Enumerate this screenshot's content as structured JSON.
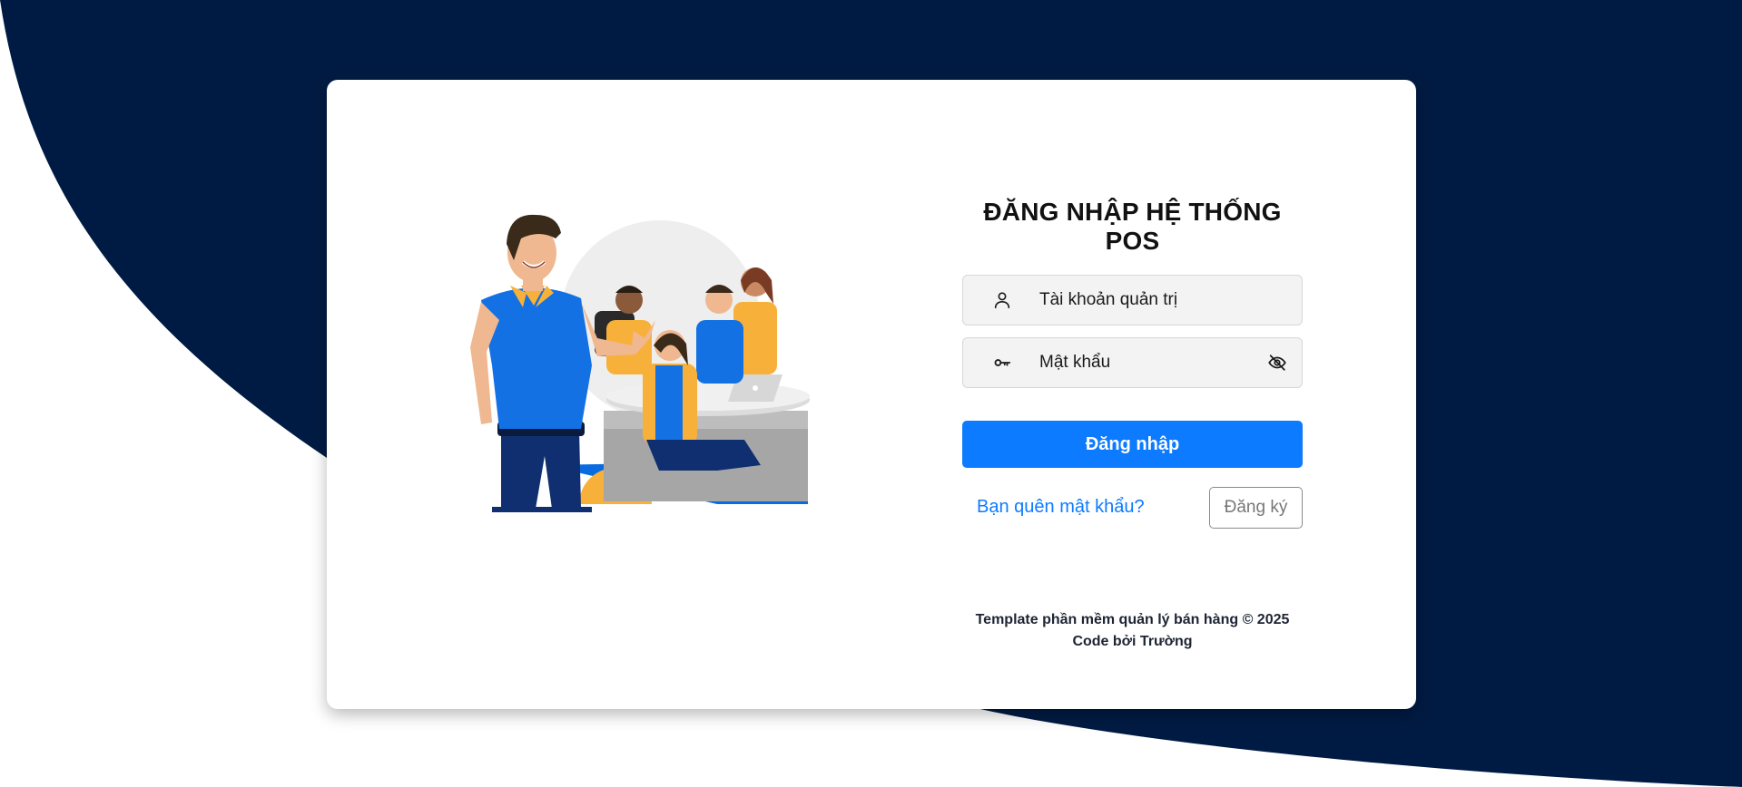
{
  "colors": {
    "navy_background": "#001b43",
    "primary": "#0d7bff",
    "card": "#ffffff"
  },
  "illustration": {
    "name": "team-illustration"
  },
  "login": {
    "title": "ĐĂNG NHẬP HỆ THỐNG POS",
    "username": {
      "placeholder": "Tài khoản quản trị",
      "value": "",
      "icon": "user-icon"
    },
    "password": {
      "placeholder": "Mật khẩu",
      "value": "",
      "icon": "key-icon",
      "toggle_icon": "eye-off-icon"
    },
    "submit_label": "Đăng nhập",
    "forgot_label": "Bạn quên mật khẩu?",
    "register_label": "Đăng ký"
  },
  "footer": {
    "line1": "Template phần mềm quản lý bán hàng © 2025",
    "line2": "Code bởi Trường"
  }
}
